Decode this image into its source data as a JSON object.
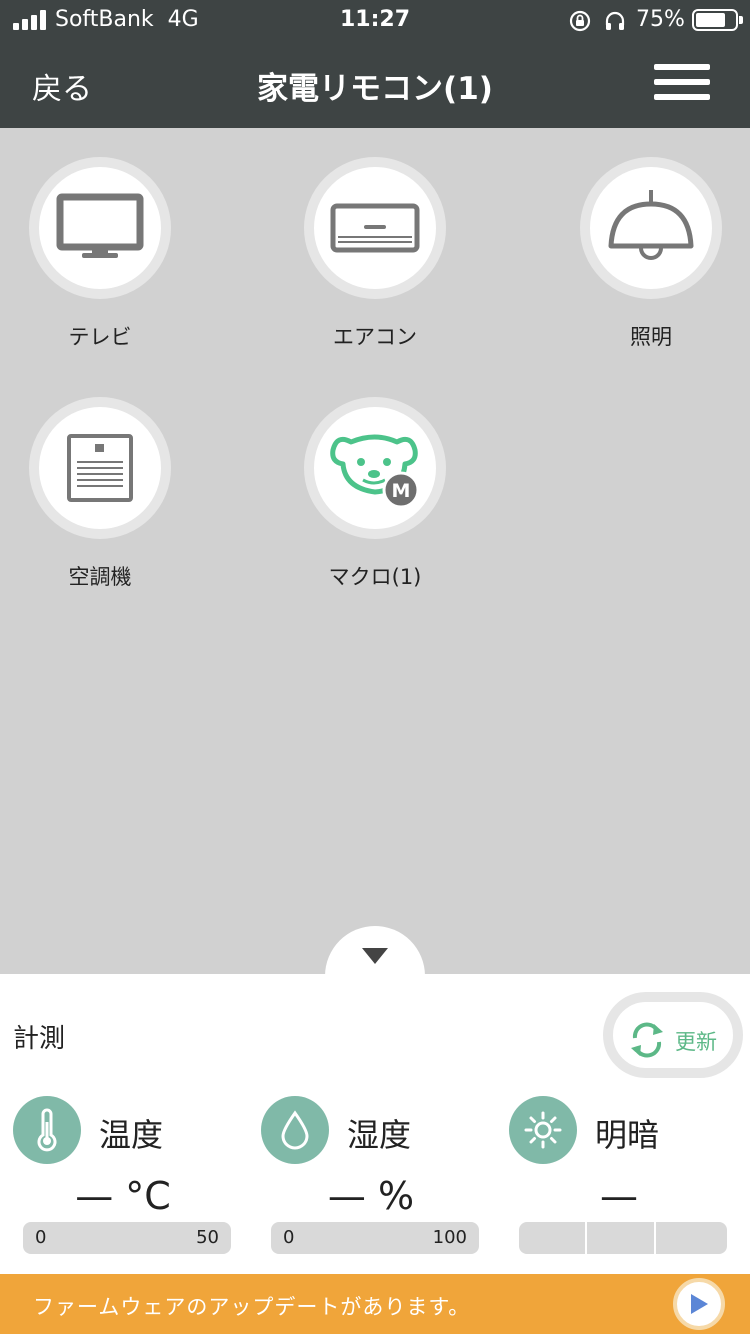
{
  "status_bar": {
    "carrier": "SoftBank",
    "network": "4G",
    "time": "11:27",
    "battery_percent": "75%",
    "battery_level": 0.75
  },
  "nav": {
    "back_label": "戻る",
    "title": "家電リモコン(1)"
  },
  "devices": [
    {
      "label": "テレビ",
      "icon": "tv-icon"
    },
    {
      "label": "エアコン",
      "icon": "air-conditioner-icon"
    },
    {
      "label": "照明",
      "icon": "ceiling-light-icon"
    },
    {
      "label": "空調機",
      "icon": "air-purifier-icon"
    },
    {
      "label": "マクロ(1)",
      "icon": "macro-dog-icon"
    }
  ],
  "measurement": {
    "title": "計測",
    "refresh_label": "更新",
    "sensors": [
      {
        "label": "温度",
        "value": "— °C",
        "min": "0",
        "max": "50",
        "icon": "thermometer-icon"
      },
      {
        "label": "湿度",
        "value": "— %",
        "min": "0",
        "max": "100",
        "icon": "water-drop-icon"
      },
      {
        "label": "明暗",
        "value": "—",
        "icon": "sun-icon"
      }
    ]
  },
  "banner": {
    "text": "ファームウェアのアップデートがあります。"
  },
  "colors": {
    "nav_bg": "#3e4444",
    "content_bg": "#d1d1d1",
    "accent_green": "#5cb887",
    "sensor_icon_bg": "#80b9a8",
    "banner_orange": "#f0a53a"
  }
}
